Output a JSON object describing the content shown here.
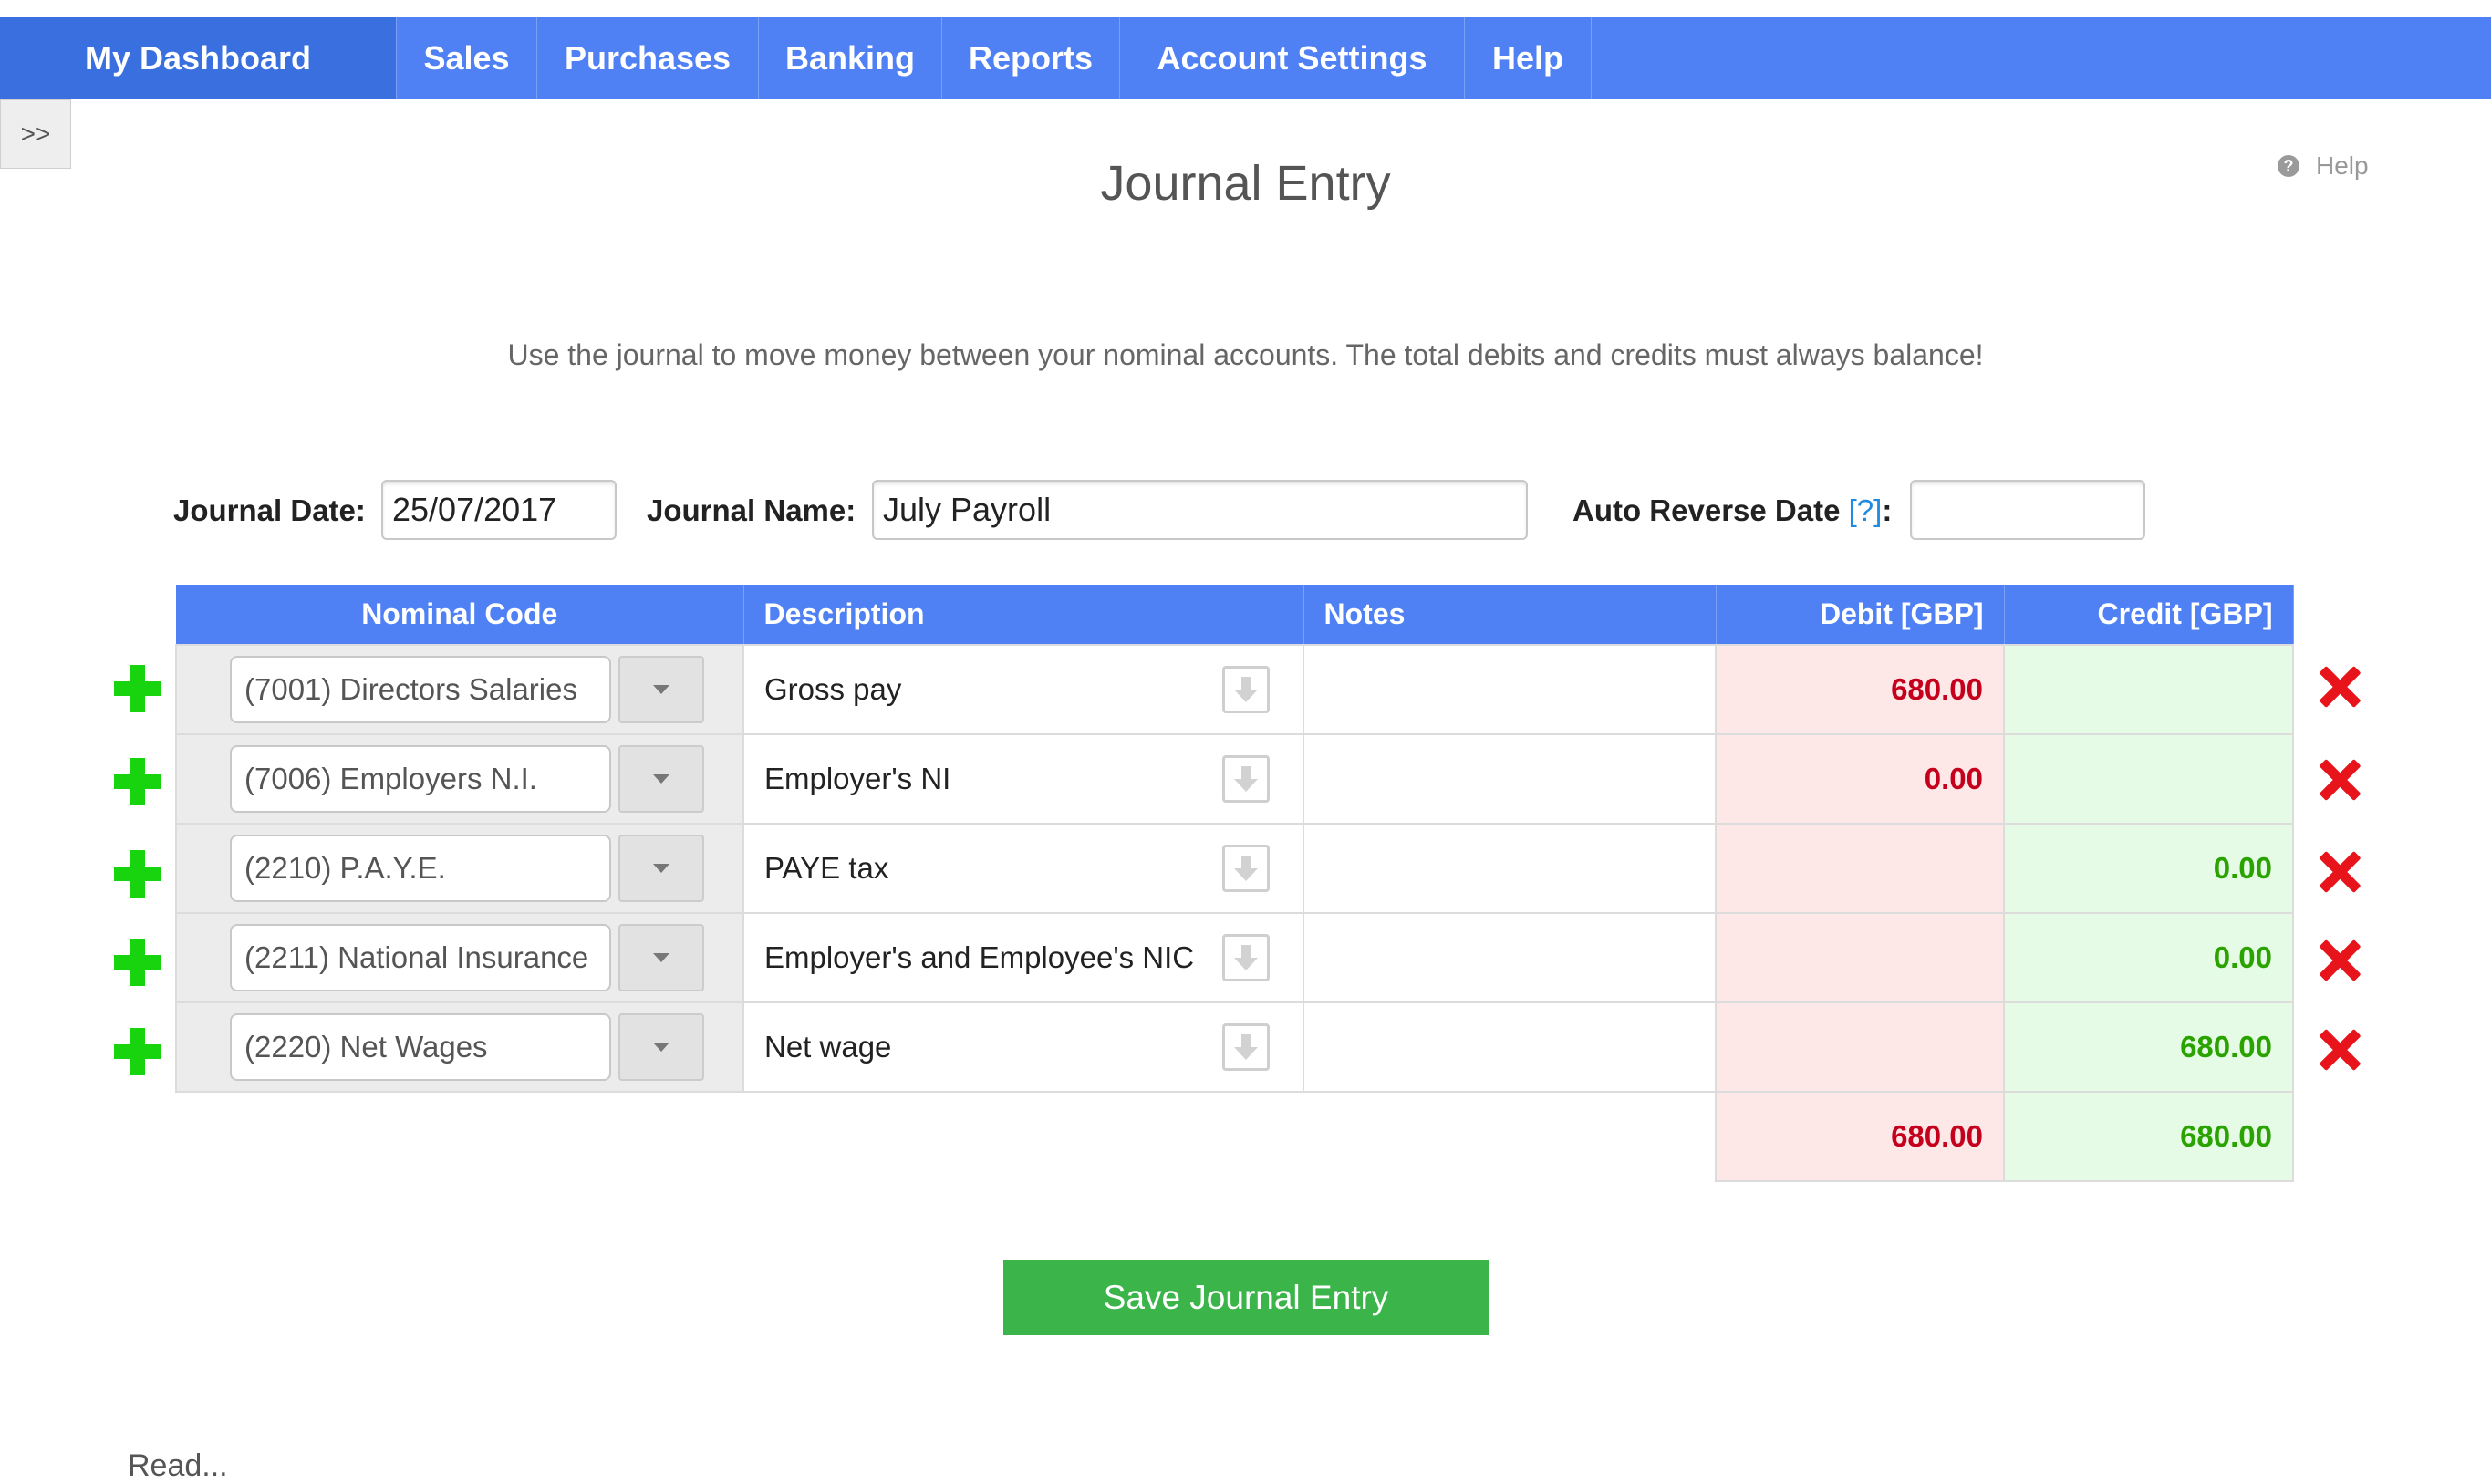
{
  "nav": {
    "items": [
      {
        "label": "My Dashboard"
      },
      {
        "label": "Sales"
      },
      {
        "label": "Purchases"
      },
      {
        "label": "Banking"
      },
      {
        "label": "Reports"
      },
      {
        "label": "Account Settings"
      },
      {
        "label": "Help"
      }
    ]
  },
  "sidebar_toggle": ">>",
  "page": {
    "title": "Journal Entry",
    "help_label": "Help",
    "intro": "Use the journal to move money between your nominal accounts. The total debits and credits must always balance!"
  },
  "form": {
    "journal_date_label": "Journal Date:",
    "journal_date_value": "25/07/2017",
    "journal_name_label": "Journal Name:",
    "journal_name_value": "July Payroll",
    "auto_reverse_label": "Auto Reverse Date",
    "auto_reverse_help": "[?]",
    "auto_reverse_colon": ":",
    "auto_reverse_value": ""
  },
  "table": {
    "headers": {
      "code": "Nominal Code",
      "description": "Description",
      "notes": "Notes",
      "debit": "Debit [GBP]",
      "credit": "Credit [GBP]"
    },
    "rows": [
      {
        "code": "(7001) Directors Salaries",
        "description": "Gross pay",
        "notes": "",
        "debit": "680.00",
        "credit": ""
      },
      {
        "code": "(7006) Employers N.I.",
        "description": "Employer's NI",
        "notes": "",
        "debit": "0.00",
        "credit": ""
      },
      {
        "code": "(2210) P.A.Y.E.",
        "description": "PAYE tax",
        "notes": "",
        "debit": "",
        "credit": "0.00"
      },
      {
        "code": "(2211) National Insurance",
        "description": "Employer's and Employee's NIC",
        "notes": "",
        "debit": "",
        "credit": "0.00"
      },
      {
        "code": "(2220) Net Wages",
        "description": "Net wage",
        "notes": "",
        "debit": "",
        "credit": "680.00"
      }
    ],
    "totals": {
      "debit": "680.00",
      "credit": "680.00"
    }
  },
  "icons": {
    "add_row": "plus-icon",
    "delete_row": "x-icon",
    "copy_down": "arrow-down-icon",
    "dropdown": "caret-down-icon",
    "help": "question-circle-icon"
  },
  "colors": {
    "nav_bg": "#4f81f5",
    "debit_text": "#c4001d",
    "credit_text": "#2aa300",
    "debit_bg": "#fde7e7",
    "credit_bg": "#e6fbe6",
    "save_bg": "#3bb54a",
    "add_icon": "#17d40f",
    "delete_icon": "#e8141b"
  },
  "actions": {
    "save_label": "Save Journal Entry"
  },
  "footer": {
    "partial_text": "Read..."
  }
}
